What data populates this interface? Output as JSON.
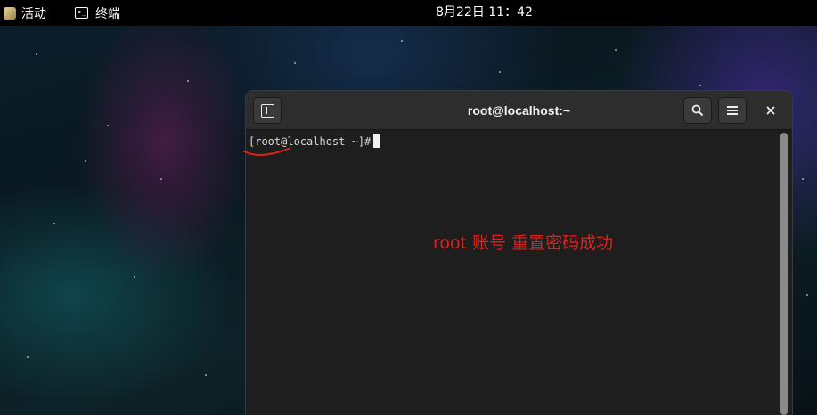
{
  "topbar": {
    "activities_label": "活动",
    "app_name": "终端",
    "clock": "8月22日  11：42"
  },
  "terminal": {
    "title": "root@localhost:~",
    "prompt": "[root@localhost ~]#",
    "icons": {
      "new_tab": "new-tab-icon",
      "search": "search-icon",
      "menu": "hamburger-menu-icon",
      "close": "close-icon"
    }
  },
  "annotation": {
    "text": "root 账号 重置密码成功",
    "color": "#e0201a"
  },
  "colors": {
    "terminal_bg": "#1e1e1e",
    "headerbar_bg": "#2d2d2d",
    "topbar_bg": "#000000"
  }
}
